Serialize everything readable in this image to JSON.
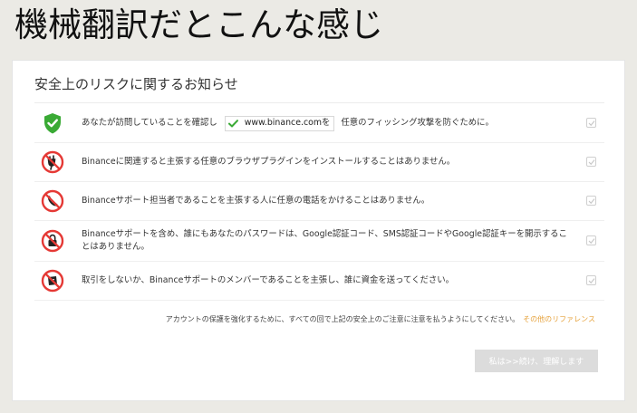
{
  "banner": {
    "text": "機械翻訳だとこんな感じ"
  },
  "notice": {
    "title": "安全上のリスクに関するお知らせ",
    "items": [
      {
        "icon": "green-shield-check-icon",
        "before": "あなたが訪問していることを確認し",
        "url": "www.binance.comを",
        "after": "任意のフィッシング攻撃を防ぐために。"
      },
      {
        "icon": "no-plugin-icon",
        "text": "Binanceに関連すると主張する任意のブラウザプラグインをインストールすることはありません。"
      },
      {
        "icon": "no-phone-call-icon",
        "text": "Binanceサポート担当者であることを主張する人に任意の電話をかけることはありません。"
      },
      {
        "icon": "no-password-sharing-icon",
        "text": "Binanceサポートを含め、誰にもあなたのパスワードは、Google認証コード、SMS認証コードやGoogle認証キーを開示することはありません。"
      },
      {
        "icon": "no-money-transfer-icon",
        "text": "取引をしないか、Binanceサポートのメンバーであることを主張し、誰に資金を送ってください。"
      }
    ],
    "footnote": "アカウントの保護を強化するために、すべての回で上記の安全上のご注意に注意を払うようにしてください。",
    "footnote_link": "その他のリファレンス",
    "confirm_button": "私は>>続け、理解します"
  },
  "colors": {
    "accent_green": "#3aaa35",
    "warning_red": "#e53935",
    "link_orange": "#e6a23c",
    "disabled_button": "#dcdcdc"
  }
}
